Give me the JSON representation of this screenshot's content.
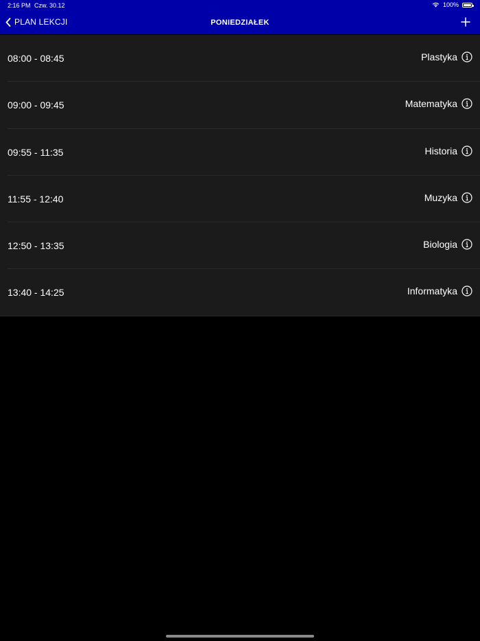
{
  "status_bar": {
    "time": "2:16 PM",
    "date": "Czw. 30.12",
    "battery": "100%",
    "wifi_icon": "wifi-icon",
    "battery_icon": "battery-icon"
  },
  "nav": {
    "back_label": "PLAN LEKCJI",
    "title": "PONIEDZIAŁEK",
    "back_icon": "chevron-left-icon",
    "add_icon": "plus-icon"
  },
  "lessons": [
    {
      "time": "08:00 - 08:45",
      "subject": "Plastyka"
    },
    {
      "time": "09:00 - 09:45",
      "subject": "Matematyka"
    },
    {
      "time": "09:55 - 11:35",
      "subject": "Historia"
    },
    {
      "time": "11:55 - 12:40",
      "subject": "Muzyka"
    },
    {
      "time": "12:50 - 13:35",
      "subject": "Biologia"
    },
    {
      "time": "13:40 - 14:25",
      "subject": "Informatyka"
    }
  ],
  "colors": {
    "header_background": "#0000a8",
    "list_background": "#1b1b1b",
    "page_background": "#000000",
    "text": "#ffffff"
  }
}
